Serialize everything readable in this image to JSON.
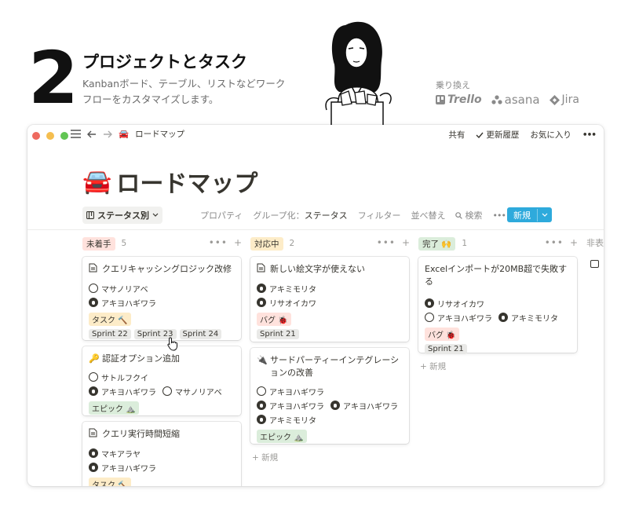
{
  "hero": {
    "number": "2",
    "title": "プロジェクトとタスク",
    "description": "Kanbanボード、テーブル、リストなどワークフローをカスタマイズします。",
    "switch_label": "乗り換え",
    "logos": [
      "Trello",
      "asana",
      "Jira"
    ]
  },
  "window": {
    "breadcrumb_emoji": "🚘",
    "breadcrumb": "ロードマップ",
    "share": "共有",
    "history": "更新履歴",
    "favorite": "お気に入り",
    "more": "•••"
  },
  "page": {
    "emoji": "🚘",
    "title": "ロードマップ"
  },
  "toolbar": {
    "view": "ステータス別",
    "properties": "プロパティ",
    "group_by_label": "グループ化：",
    "group_by_value": "ステータス",
    "filter": "フィルター",
    "sort": "並べ替え",
    "search": "検索",
    "more": "•••",
    "new": "新規"
  },
  "columns": [
    {
      "name": "未着手",
      "count": "5",
      "color": "#ffe2dd",
      "cards": [
        {
          "icon": "page-icon",
          "title": "クエリキャッシングロジック改修",
          "people": [
            [
              "マサノリアベ"
            ],
            [
              "アキヨハギワラ"
            ]
          ],
          "chips": [
            {
              "label": "タスク 🔨",
              "kind": "task"
            }
          ],
          "sprints": [
            "Sprint 22",
            "Sprint 23",
            "Sprint 24"
          ]
        },
        {
          "icon": "key-icon",
          "title": "認証オプション追加",
          "people": [
            [
              "サトルフクイ"
            ],
            [
              "アキヨハギワラ",
              "マサノリアベ"
            ]
          ],
          "chips": [
            {
              "label": "エピック ⛰️",
              "kind": "epic"
            }
          ],
          "sprints": []
        },
        {
          "icon": "page-icon",
          "title": "クエリ実行時間短縮",
          "people": [
            [
              "マキアラヤ"
            ],
            [
              "アキヨハギワラ"
            ]
          ],
          "chips": [
            {
              "label": "タスク 🔨",
              "kind": "task"
            }
          ],
          "sprints": []
        }
      ]
    },
    {
      "name": "対応中",
      "count": "2",
      "color": "#fdecc8",
      "cards": [
        {
          "icon": "page-icon",
          "title": "新しい絵文字が使えない",
          "people": [
            [
              "アキミモリタ"
            ],
            [
              "リサオイカワ"
            ]
          ],
          "chips": [
            {
              "label": "バグ 🐞",
              "kind": "bug"
            }
          ],
          "sprints": [
            "Sprint 21"
          ]
        },
        {
          "icon": "plug-icon",
          "title": "サードパーティーインテグレーションの改善",
          "people": [
            [
              "アキヨハギワラ"
            ],
            [
              "アキヨハギワラ",
              "アキヨハギワラ"
            ],
            [
              "アキミモリタ"
            ]
          ],
          "chips": [
            {
              "label": "エピック ⛰️",
              "kind": "epic"
            }
          ],
          "sprints": []
        }
      ],
      "new": "新規"
    },
    {
      "name": "完了 🙌",
      "count": "1",
      "color": "#dbeddb",
      "cards": [
        {
          "icon": "",
          "title": "Excelインポートが20MB超で失敗する",
          "people": [
            [
              "リサオイカワ"
            ],
            [
              "アキヨハギワラ",
              "アキミモリタ"
            ]
          ],
          "chips": [
            {
              "label": "バグ 🐞",
              "kind": "bug"
            }
          ],
          "sprints": [
            "Sprint 21"
          ]
        }
      ],
      "new": "新規"
    }
  ],
  "hidden_label": "非表"
}
